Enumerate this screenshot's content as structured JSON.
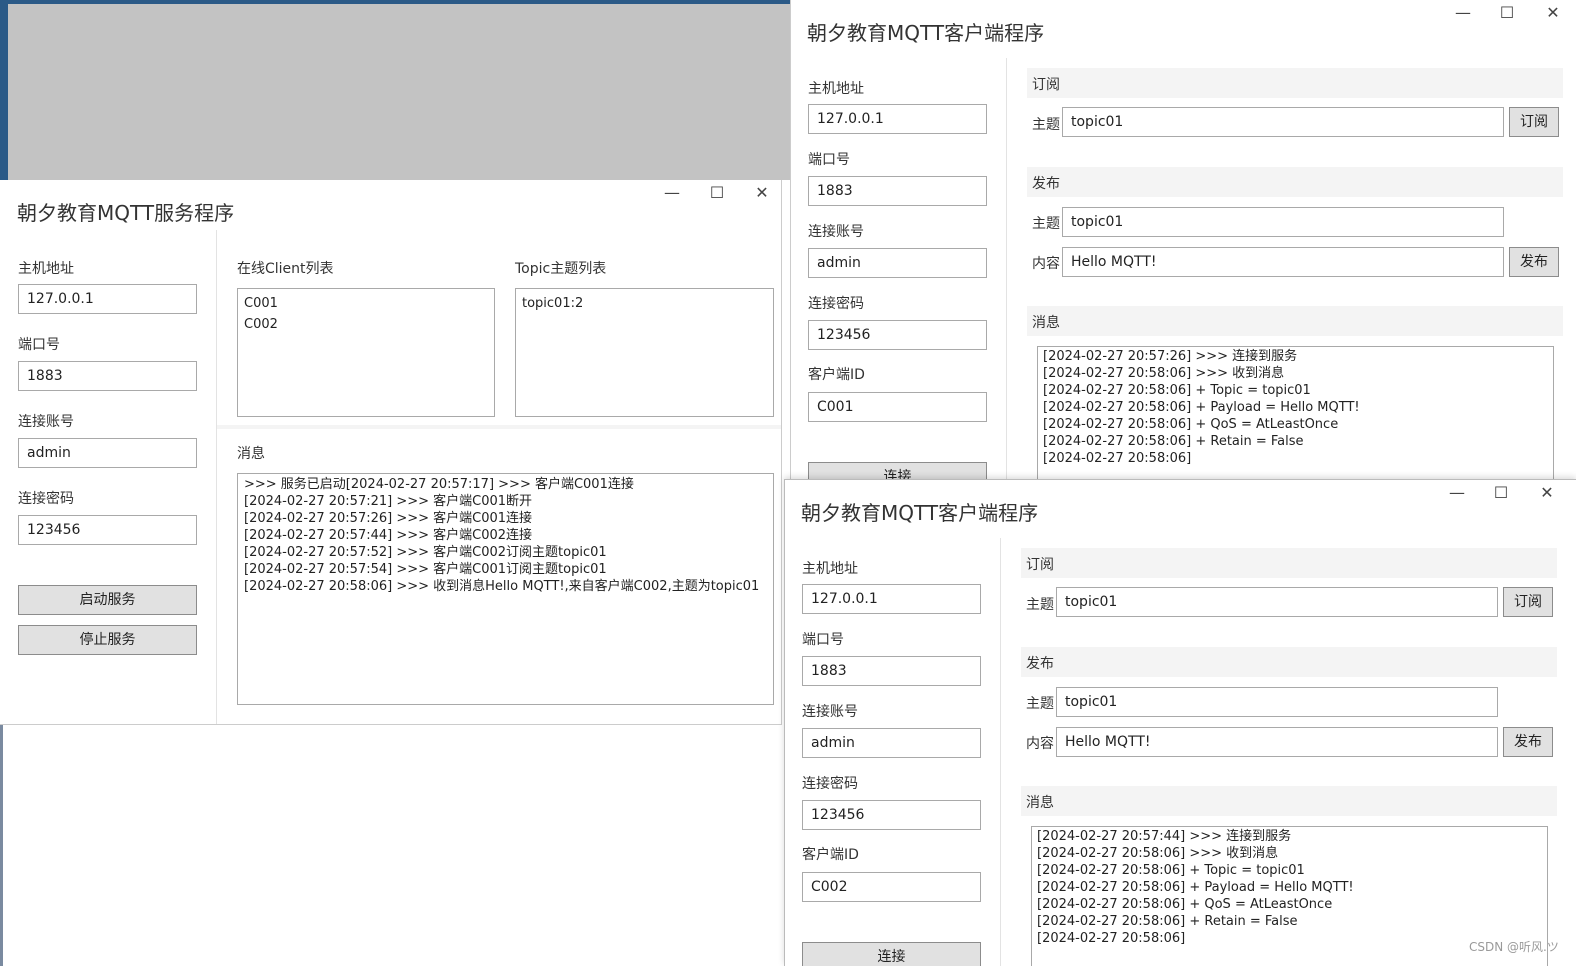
{
  "server": {
    "title": "朝夕教育MQTT服务程序",
    "controls": {
      "minimize": "—",
      "maximize": "☐",
      "close": "✕"
    },
    "host": {
      "label": "主机地址",
      "value": "127.0.0.1"
    },
    "port": {
      "label": "端口号",
      "value": "1883"
    },
    "account": {
      "label": "连接账号",
      "value": "admin"
    },
    "password": {
      "label": "连接密码",
      "value": "123456"
    },
    "start_button": "启动服务",
    "stop_button": "停止服务",
    "clients_label": "在线Client列表",
    "clients": [
      "C001",
      "C002"
    ],
    "topics_label": "Topic主题列表",
    "topics": [
      "topic01:2"
    ],
    "messages_label": "消息",
    "messages": [
      ">>> 服务已启动[2024-02-27 20:57:17] >>> 客户端C001连接",
      "[2024-02-27 20:57:21] >>> 客户端C001断开",
      "[2024-02-27 20:57:26] >>> 客户端C001连接",
      "[2024-02-27 20:57:44] >>> 客户端C002连接",
      "[2024-02-27 20:57:52] >>> 客户端C002订阅主题topic01",
      "[2024-02-27 20:57:54] >>> 客户端C001订阅主题topic01",
      "[2024-02-27 20:58:06] >>> 收到消息Hello MQTT!,来自客户端C002,主题为topic01"
    ]
  },
  "client1": {
    "title": "朝夕教育MQTT客户端程序",
    "controls": {
      "minimize": "—",
      "maximize": "☐",
      "close": "✕"
    },
    "host": {
      "label": "主机地址",
      "value": "127.0.0.1"
    },
    "port": {
      "label": "端口号",
      "value": "1883"
    },
    "account": {
      "label": "连接账号",
      "value": "admin"
    },
    "password": {
      "label": "连接密码",
      "value": "123456"
    },
    "client_id": {
      "label": "客户端ID",
      "value": "C001"
    },
    "connect_button": "连接",
    "subscribe": {
      "header": "订阅",
      "topic_label": "主题",
      "topic_value": "topic01",
      "button": "订阅"
    },
    "publish": {
      "header": "发布",
      "topic_label": "主题",
      "topic_value": "topic01",
      "content_label": "内容",
      "content_value": "Hello MQTT!",
      "button": "发布"
    },
    "messages_label": "消息",
    "messages": [
      "[2024-02-27 20:57:26] >>> 连接到服务",
      "[2024-02-27 20:58:06] >>> 收到消息",
      "[2024-02-27 20:58:06] + Topic = topic01",
      "[2024-02-27 20:58:06] + Payload = Hello MQTT!",
      "[2024-02-27 20:58:06] + QoS = AtLeastOnce",
      "[2024-02-27 20:58:06] + Retain = False",
      "[2024-02-27 20:58:06]"
    ]
  },
  "client2": {
    "title": "朝夕教育MQTT客户端程序",
    "controls": {
      "minimize": "—",
      "maximize": "☐",
      "close": "✕"
    },
    "host": {
      "label": "主机地址",
      "value": "127.0.0.1"
    },
    "port": {
      "label": "端口号",
      "value": "1883"
    },
    "account": {
      "label": "连接账号",
      "value": "admin"
    },
    "password": {
      "label": "连接密码",
      "value": "123456"
    },
    "client_id": {
      "label": "客户端ID",
      "value": "C002"
    },
    "connect_button": "连接",
    "subscribe": {
      "header": "订阅",
      "topic_label": "主题",
      "topic_value": "topic01",
      "button": "订阅"
    },
    "publish": {
      "header": "发布",
      "topic_label": "主题",
      "topic_value": "topic01",
      "content_label": "内容",
      "content_value": "Hello MQTT!",
      "button": "发布"
    },
    "messages_label": "消息",
    "messages": [
      "[2024-02-27 20:57:44] >>> 连接到服务",
      "[2024-02-27 20:58:06] >>> 收到消息",
      "[2024-02-27 20:58:06] + Topic = topic01",
      "[2024-02-27 20:58:06] + Payload = Hello MQTT!",
      "[2024-02-27 20:58:06] + QoS = AtLeastOnce",
      "[2024-02-27 20:58:06] + Retain = False",
      "[2024-02-27 20:58:06]"
    ]
  },
  "watermark": "CSDN @听风.ツ",
  "colors": {
    "gray_area": "#c3c3c3",
    "taskbar": "#2b5a87",
    "button_bg": "#e1e1e1",
    "border": "#a9a9a9"
  }
}
